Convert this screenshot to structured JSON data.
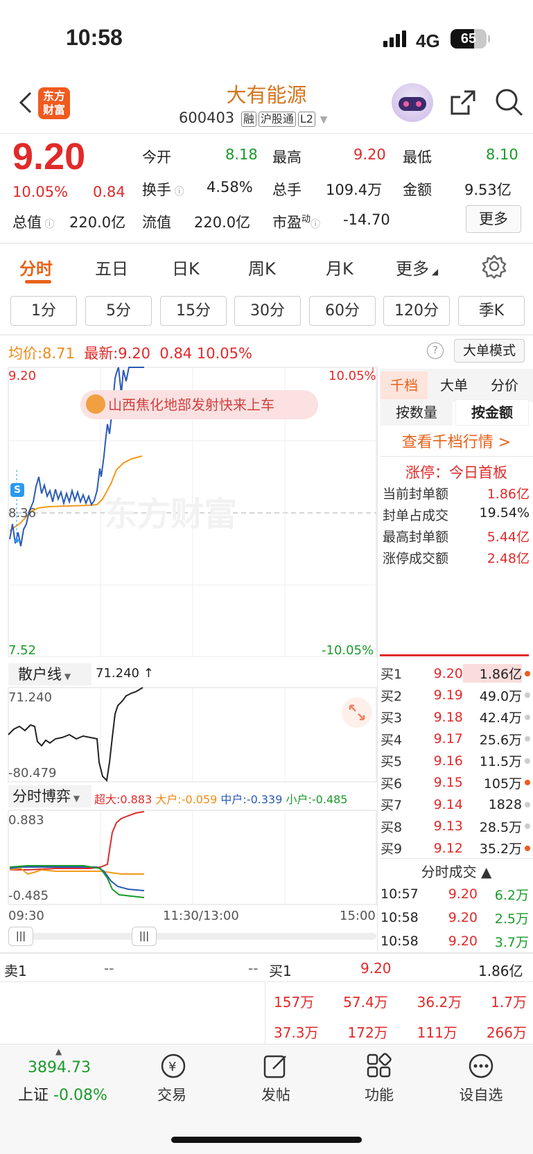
{
  "status": {
    "time": "10:58",
    "network": "4G",
    "battery": "65"
  },
  "header": {
    "title": "大有能源",
    "code": "600403",
    "tags": [
      "融",
      "沪股通",
      "L2"
    ],
    "logo": "东方\n财富"
  },
  "quote": {
    "price": "9.20",
    "pct": "10.05%",
    "chg": "0.84",
    "open_l": "今开",
    "open": "8.18",
    "high_l": "最高",
    "high": "9.20",
    "low_l": "最低",
    "low": "8.10",
    "turn_l": "换手",
    "turn": "4.58%",
    "vol_l": "总手",
    "vol": "109.4万",
    "amt_l": "金额",
    "amt": "9.53亿",
    "mcap_l": "总值",
    "mcap": "220.0亿",
    "flt_l": "流值",
    "flt": "220.0亿",
    "pe_l": "市盈",
    "pe_sup": "动",
    "pe": "-14.70",
    "more": "更多"
  },
  "tabs": [
    "分时",
    "五日",
    "日K",
    "周K",
    "月K",
    "更多"
  ],
  "periods": [
    "1分",
    "5分",
    "15分",
    "30分",
    "60分",
    "120分",
    "季K"
  ],
  "infobar": {
    "avg_l": "均价:",
    "avg": "8.71",
    "latest_l": "最新:",
    "latest": "9.20",
    "chg": "0.84",
    "pct": "10.05%",
    "help": "?",
    "mode": "大单模式"
  },
  "chart": {
    "ymax": "9.20",
    "ymid": "8.36",
    "ymin": "7.52",
    "pmax": "10.05%",
    "pmin": "-10.05%",
    "banner": "山西焦化地部发射快来上车",
    "watermark": "东方财富",
    "marker": "S"
  },
  "retail": {
    "label": "散户线",
    "value": "71.240 ↑",
    "max": "71.240",
    "min": "-80.479"
  },
  "game": {
    "label": "分时博弈",
    "super_l": "超大:",
    "super": "0.883",
    "big_l": "大户:",
    "big": "-0.059",
    "mid_l": "中户:",
    "mid": "-0.339",
    "small_l": "小户:",
    "small": "-0.485",
    "max": "0.883",
    "min": "-0.485"
  },
  "xaxis": {
    "start": "09:30",
    "mid": "11:30/13:00",
    "end": "15:00"
  },
  "side": {
    "tabs": [
      "千档",
      "大单",
      "分价"
    ],
    "sub": [
      "按数量",
      "按金额"
    ],
    "link": "查看千档行情 >",
    "limit": "涨停：今日首板",
    "stats": [
      {
        "l": "当前封单额",
        "v": "1.86亿"
      },
      {
        "l": "封单占成交",
        "v": "19.54%"
      },
      {
        "l": "最高封单额",
        "v": "5.44亿"
      },
      {
        "l": "涨停成交额",
        "v": "2.48亿"
      }
    ],
    "bids": [
      {
        "l": "买1",
        "p": "9.20",
        "v": "1.86亿",
        "dot": "#f05a1e"
      },
      {
        "l": "买2",
        "p": "9.19",
        "v": "49.0万",
        "dot": "#ccc"
      },
      {
        "l": "买3",
        "p": "9.18",
        "v": "42.4万",
        "dot": "#ccc"
      },
      {
        "l": "买4",
        "p": "9.17",
        "v": "25.6万",
        "dot": "#ccc"
      },
      {
        "l": "买5",
        "p": "9.16",
        "v": "11.5万",
        "dot": "#ccc"
      },
      {
        "l": "买6",
        "p": "9.15",
        "v": "105万",
        "dot": "#f05a1e"
      },
      {
        "l": "买7",
        "p": "9.14",
        "v": "1828",
        "dot": "#ccc"
      },
      {
        "l": "买8",
        "p": "9.13",
        "v": "28.5万",
        "dot": "#ccc"
      },
      {
        "l": "买9",
        "p": "9.12",
        "v": "35.2万",
        "dot": "#f05a1e"
      }
    ],
    "ticks_l": "分时成交 ▲",
    "ticks": [
      {
        "t": "10:57",
        "p": "9.20",
        "v": "6.2万"
      },
      {
        "t": "10:58",
        "p": "9.20",
        "v": "2.5万"
      },
      {
        "t": "10:58",
        "p": "9.20",
        "v": "3.7万"
      }
    ]
  },
  "orders": {
    "sell_l": "卖1",
    "sell_p": "--",
    "sell_v": "--",
    "buy_l": "买1",
    "buy_p": "9.20",
    "buy_v": "1.86亿",
    "row1": [
      "157万",
      "57.4万",
      "36.2万",
      "1.7万"
    ],
    "row2": [
      "37.3万",
      "172万",
      "111万",
      "266万"
    ]
  },
  "nav": {
    "index_val": "3894.73",
    "index_l": "上证",
    "index_pct": "-0.08%",
    "items": [
      "交易",
      "发帖",
      "功能",
      "设自选"
    ]
  }
}
